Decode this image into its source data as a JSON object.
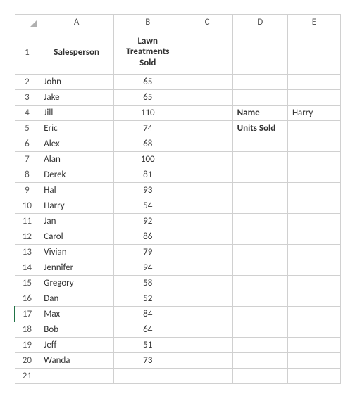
{
  "columns": [
    "A",
    "B",
    "C",
    "D",
    "E"
  ],
  "rows": [
    "1",
    "2",
    "3",
    "4",
    "5",
    "6",
    "7",
    "8",
    "9",
    "10",
    "11",
    "12",
    "13",
    "14",
    "15",
    "16",
    "17",
    "18",
    "19",
    "20",
    "21"
  ],
  "active_row": 17,
  "header": {
    "A": "Salesperson",
    "B": "Lawn Treatments Sold"
  },
  "data": [
    {
      "name": "John",
      "sold": "65"
    },
    {
      "name": "Jake",
      "sold": "65"
    },
    {
      "name": "Jill",
      "sold": "110"
    },
    {
      "name": "Eric",
      "sold": "74"
    },
    {
      "name": "Alex",
      "sold": "68"
    },
    {
      "name": "Alan",
      "sold": "100"
    },
    {
      "name": "Derek",
      "sold": "81"
    },
    {
      "name": "Hal",
      "sold": "93"
    },
    {
      "name": "Harry",
      "sold": "54"
    },
    {
      "name": "Jan",
      "sold": "92"
    },
    {
      "name": "Carol",
      "sold": "86"
    },
    {
      "name": "Vivian",
      "sold": "79"
    },
    {
      "name": "Jennifer",
      "sold": "94"
    },
    {
      "name": "Gregory",
      "sold": "58"
    },
    {
      "name": "Dan",
      "sold": "52"
    },
    {
      "name": "Max",
      "sold": "84"
    },
    {
      "name": "Bob",
      "sold": "64"
    },
    {
      "name": "Jeff",
      "sold": "51"
    },
    {
      "name": "Wanda",
      "sold": "73"
    }
  ],
  "lookup": {
    "name_label": "Name",
    "name_value": "Harry",
    "units_label": "Units Sold",
    "units_value": ""
  }
}
